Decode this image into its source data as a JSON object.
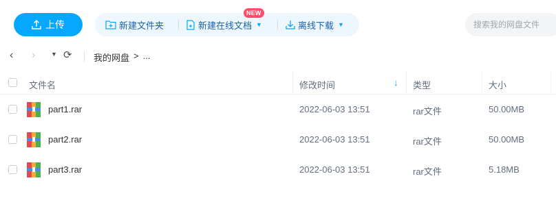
{
  "toolbar": {
    "upload_label": "上传",
    "new_folder_label": "新建文件夹",
    "new_online_doc_label": "新建在线文档",
    "new_badge": "NEW",
    "offline_download_label": "离线下载",
    "search_placeholder": "搜索我的网盘文件"
  },
  "nav": {
    "breadcrumb_root": "我的网盘",
    "breadcrumb_sep": ">",
    "breadcrumb_more": "..."
  },
  "table": {
    "columns": {
      "name": "文件名",
      "modified": "修改时间",
      "type": "类型",
      "size": "大小"
    },
    "rows": [
      {
        "name": "part1.rar",
        "modified": "2022-06-03 13:51",
        "type": "rar文件",
        "size": "50.00MB"
      },
      {
        "name": "part2.rar",
        "modified": "2022-06-03 13:51",
        "type": "rar文件",
        "size": "50.00MB"
      },
      {
        "name": "part3.rar",
        "modified": "2022-06-03 13:51",
        "type": "rar文件",
        "size": "5.18MB"
      }
    ]
  },
  "colors": {
    "accent": "#06a7ff",
    "toolbar_group_bg": "#eef7fe",
    "badge": "#ff4d6a"
  }
}
